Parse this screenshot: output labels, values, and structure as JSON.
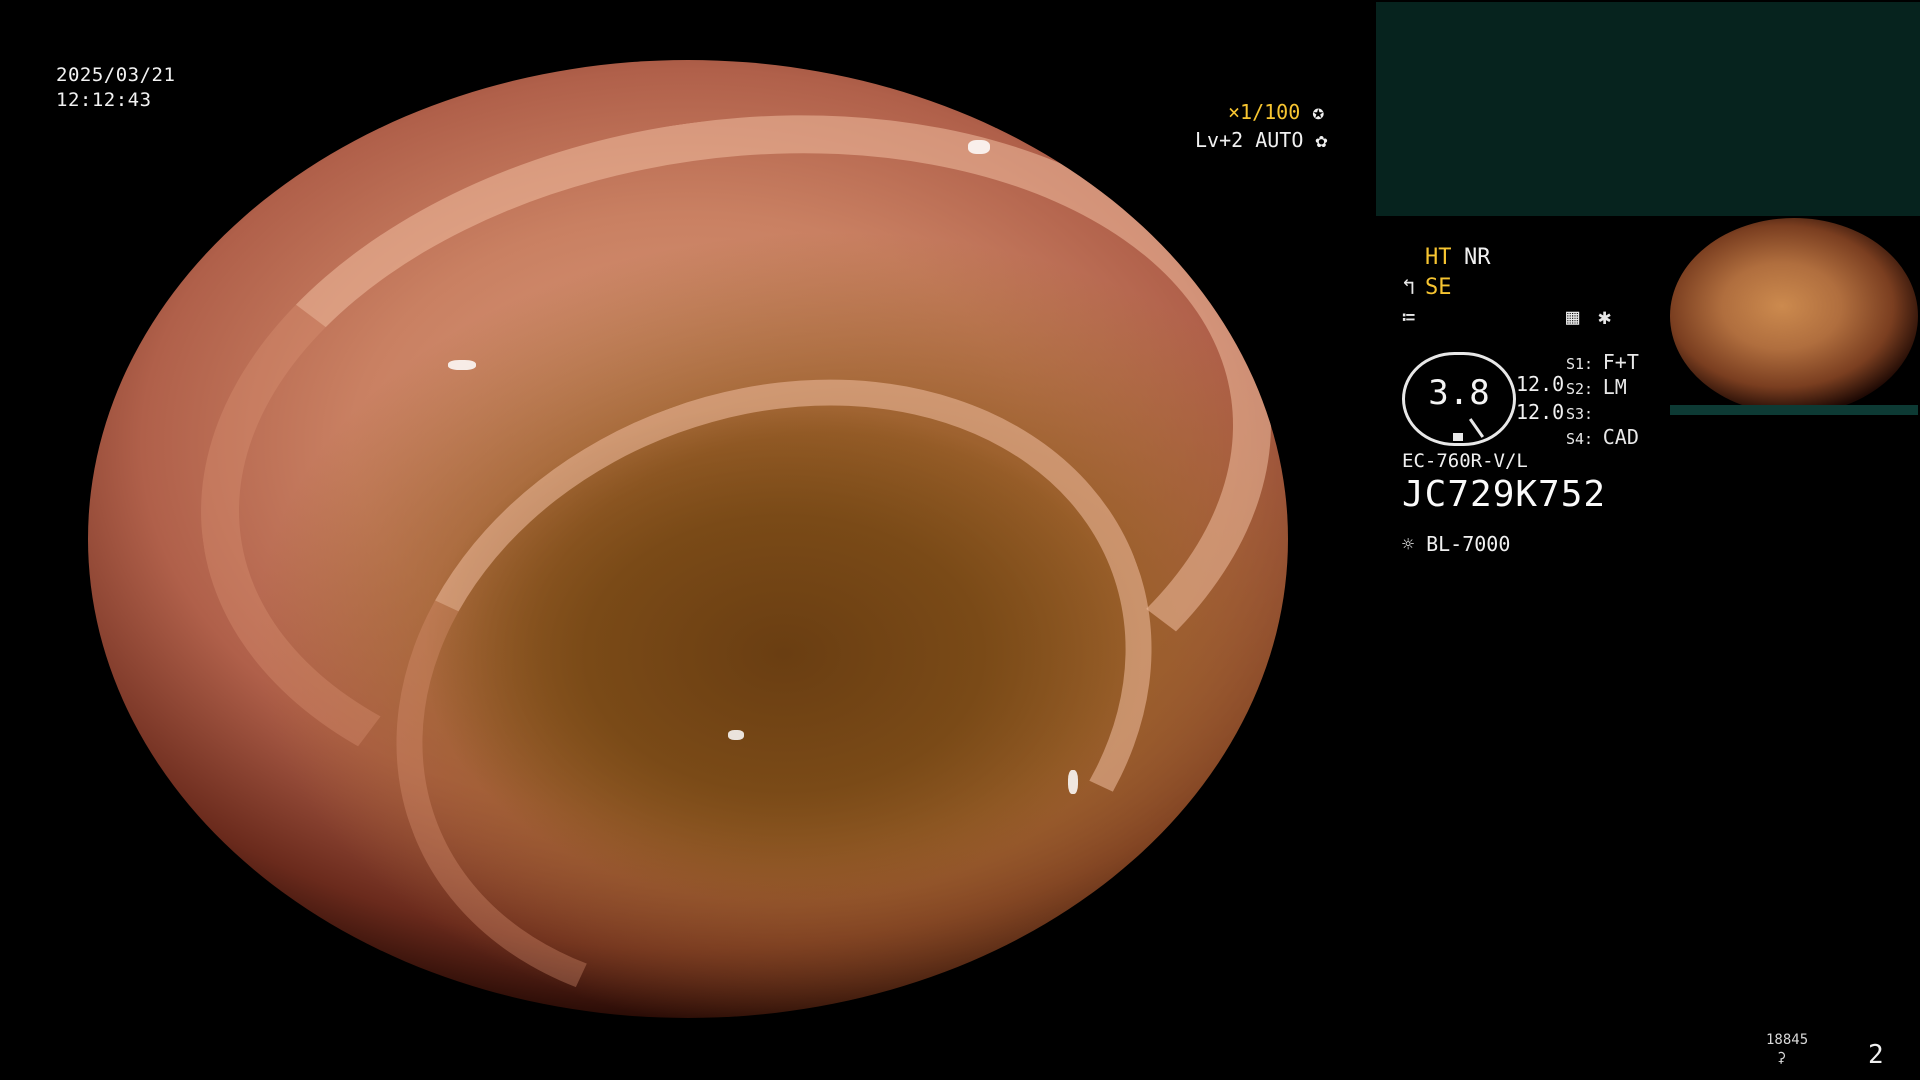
{
  "datetime": {
    "date": "2025/03/21",
    "time": "12:12:43"
  },
  "shutter": {
    "value": "×1/100",
    "icon": "shutter-icon"
  },
  "exposure": {
    "value": "Lv+2 AUTO",
    "icon": "iris-icon"
  },
  "modes": {
    "ht": "HT",
    "nr": "NR",
    "se": "SE"
  },
  "gauge": {
    "value": "3.8",
    "left_top": "12.0",
    "left_bottom": "12.0"
  },
  "switches": [
    {
      "key": "S1:",
      "value": "F+T"
    },
    {
      "key": "S2:",
      "value": "LM"
    },
    {
      "key": "S3:",
      "value": ""
    },
    {
      "key": "S4:",
      "value": "CAD"
    }
  ],
  "scope": {
    "model": "EC-760R-V/L",
    "serial": "JC729K752"
  },
  "light": {
    "model": "BL-7000",
    "icon": "light-source-icon"
  },
  "footer": {
    "count": "18845",
    "page": "2"
  },
  "colors": {
    "accent": "#f7c531",
    "panel": "#06231e",
    "text": "#f0f0f0"
  }
}
